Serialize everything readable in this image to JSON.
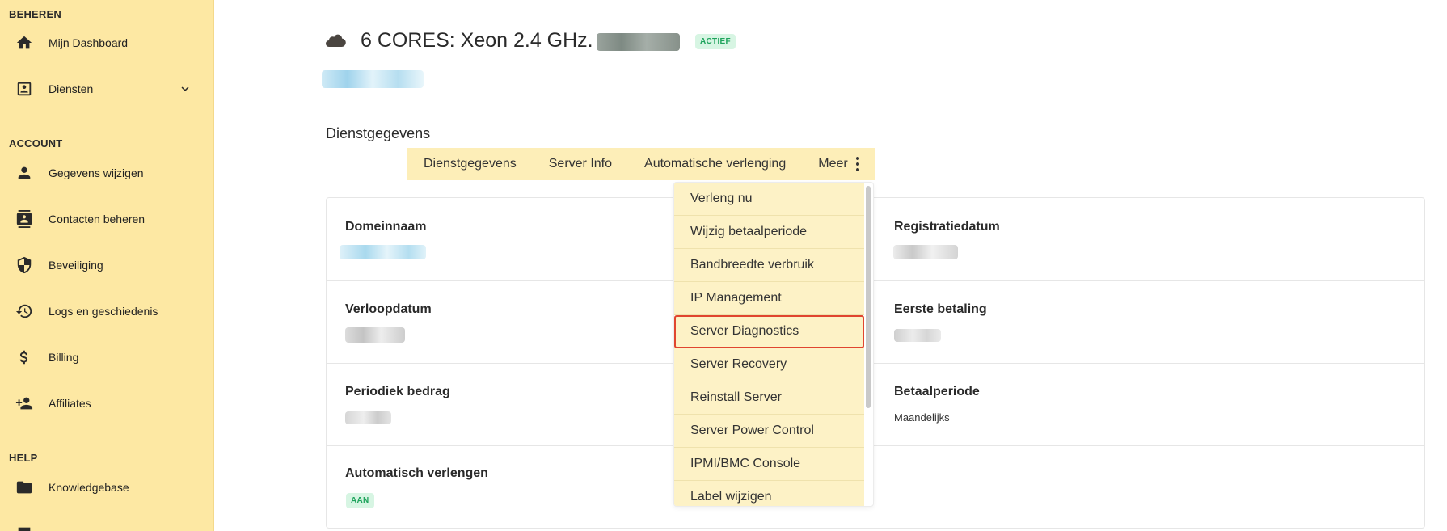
{
  "sidebar": {
    "sections": [
      {
        "title": "BEHEREN"
      },
      {
        "title": "ACCOUNT"
      },
      {
        "title": "HELP"
      }
    ],
    "items": [
      {
        "label": "Mijn Dashboard",
        "icon": "home-icon"
      },
      {
        "label": "Diensten",
        "icon": "contact-card-icon"
      },
      {
        "label": "Gegevens wijzigen",
        "icon": "person-icon"
      },
      {
        "label": "Contacten beheren",
        "icon": "contacts-icon"
      },
      {
        "label": "Beveiliging",
        "icon": "shield-icon"
      },
      {
        "label": "Logs en geschiedenis",
        "icon": "history-icon"
      },
      {
        "label": "Billing",
        "icon": "dollar-icon"
      },
      {
        "label": "Affiliates",
        "icon": "person-add-icon"
      },
      {
        "label": "Knowledgebase",
        "icon": "folder-icon"
      }
    ]
  },
  "header": {
    "title": "6 CORES: Xeon 2.4 GHz.",
    "status_badge": "ACTIEF",
    "icon": "cloud-icon"
  },
  "main": {
    "section_heading": "Dienstgegevens",
    "tabs": [
      {
        "label": "Dienstgegevens"
      },
      {
        "label": "Server Info"
      },
      {
        "label": "Automatische verlenging"
      },
      {
        "label": "Meer"
      }
    ],
    "fields": {
      "domeinnaam": {
        "label": "Domeinnaam"
      },
      "registratiedatum": {
        "label": "Registratiedatum"
      },
      "verloopdatum": {
        "label": "Verloopdatum"
      },
      "eerste_betaling": {
        "label": "Eerste betaling"
      },
      "periodiek_bedrag": {
        "label": "Periodiek bedrag"
      },
      "betaalperiode": {
        "label": "Betaalperiode",
        "value": "Maandelijks"
      },
      "automatisch_verlengen": {
        "label": "Automatisch verlengen",
        "value": "AAN"
      }
    }
  },
  "dropdown": {
    "items": [
      {
        "label": "Verleng nu"
      },
      {
        "label": "Wijzig betaalperiode"
      },
      {
        "label": "Bandbreedte verbruik"
      },
      {
        "label": "IP Management"
      },
      {
        "label": "Server Diagnostics",
        "selected": true
      },
      {
        "label": "Server Recovery"
      },
      {
        "label": "Reinstall Server"
      },
      {
        "label": "Server Power Control"
      },
      {
        "label": "IPMI/BMC Console"
      },
      {
        "label": "Label wijzigen"
      }
    ]
  },
  "colors": {
    "sidebar_bg": "#fde8a3",
    "tab_bg": "#fdeeb8",
    "dropdown_item_bg": "#fdf2c6",
    "selected_outline": "#e0452f",
    "badge_green_bg": "#d7f5e3",
    "badge_green_text": "#1ea35c"
  }
}
